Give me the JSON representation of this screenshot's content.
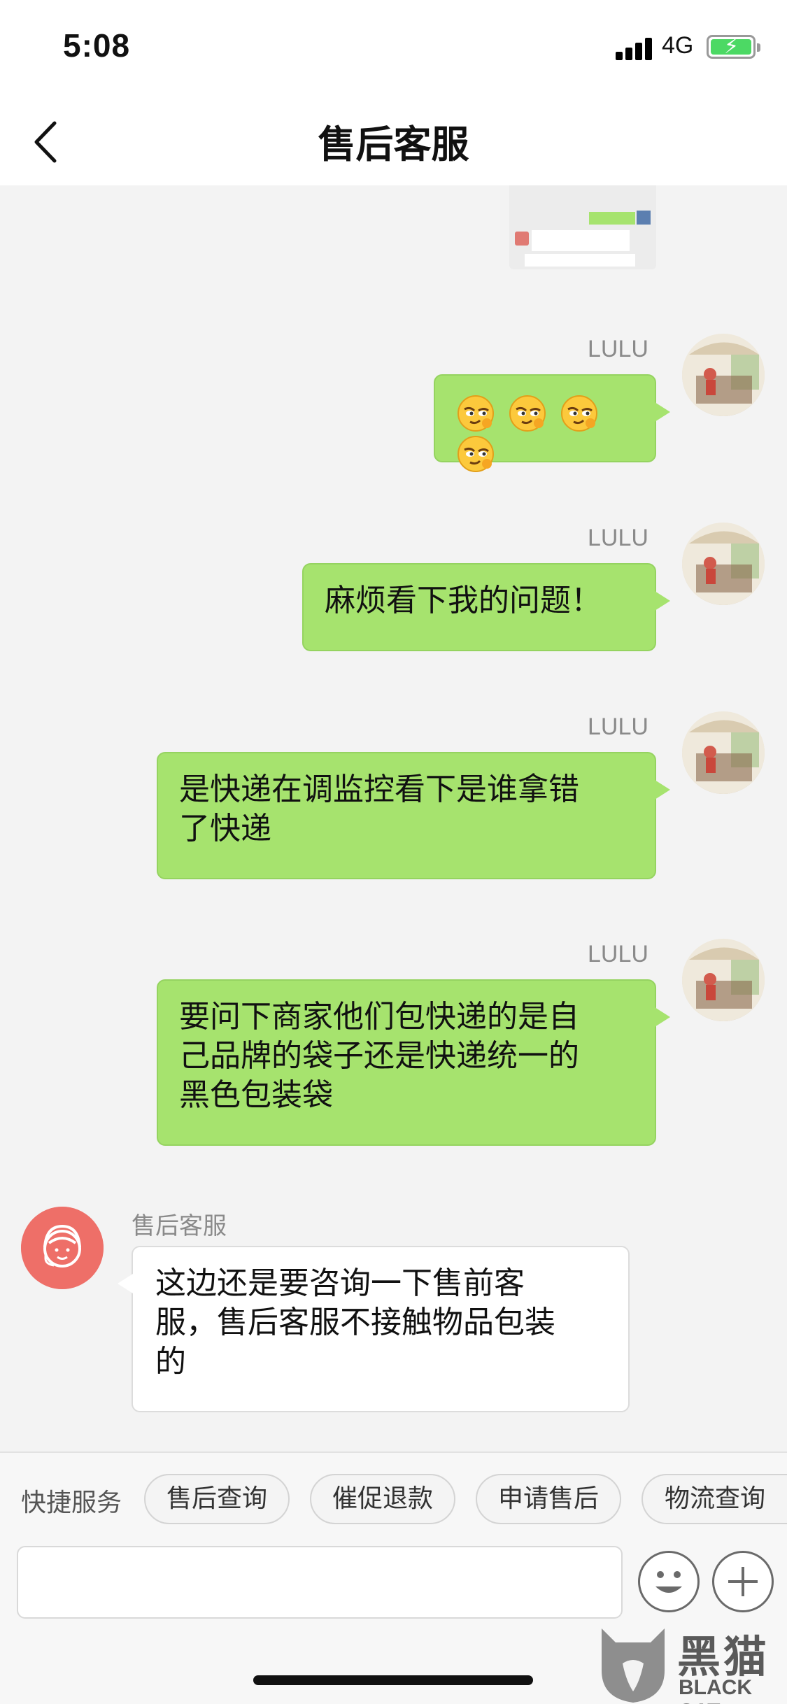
{
  "status_bar": {
    "time": "5:08",
    "network": "4G"
  },
  "header": {
    "title": "售后客服"
  },
  "messages": [
    {
      "sender": "LULU",
      "type": "emoji",
      "emojis": [
        "sly-face-emoji",
        "sly-face-emoji",
        "sly-face-emoji",
        "sly-face-emoji"
      ]
    },
    {
      "sender": "LULU",
      "type": "text",
      "text": "麻烦看下我的问题！"
    },
    {
      "sender": "LULU",
      "type": "text",
      "lines": [
        "是快递在调监控看下是谁拿错",
        "了快递"
      ]
    },
    {
      "sender": "LULU",
      "type": "text",
      "lines": [
        "要问下商家他们包快递的是自",
        "己品牌的袋子还是快递统一的",
        "黑色包装袋"
      ]
    },
    {
      "sender": "售后客服",
      "type": "text",
      "lines": [
        "这边还是要咨询一下售前客",
        "服，售后客服不接触物品包装",
        "的"
      ]
    }
  ],
  "quick_services": {
    "label": "快捷服务",
    "items": [
      "售后查询",
      "催促退款",
      "申请售后",
      "物流查询"
    ]
  },
  "watermark": {
    "name": "黑猫",
    "sub": "BLACK CAT"
  },
  "colors": {
    "outgoing_bubble": "#a6e36e",
    "incoming_bubble": "#ffffff",
    "agent_avatar": "#ee6f68",
    "background": "#f3f3f3"
  }
}
